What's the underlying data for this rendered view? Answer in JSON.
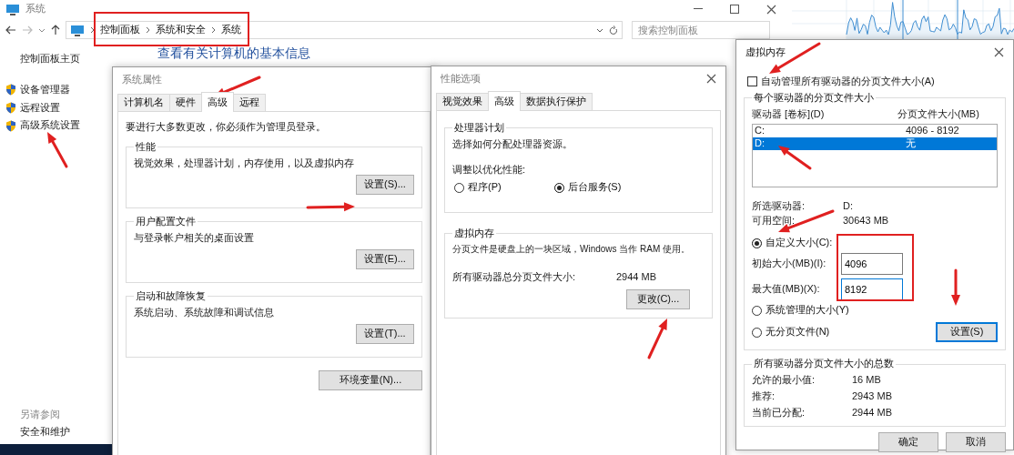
{
  "explorer": {
    "title": "系统",
    "breadcrumb": [
      "控制面板",
      "系统和安全",
      "系统"
    ],
    "search": {
      "placeholder": "搜索控制面板"
    },
    "heading": "查看有关计算机的基本信息",
    "sidebar": {
      "home": "控制面板主页",
      "items": [
        {
          "label": "设备管理器"
        },
        {
          "label": "远程设置"
        },
        {
          "label": "高级系统设置"
        }
      ],
      "see_also": "另请参阅",
      "links": [
        "安全和维护"
      ]
    }
  },
  "system_properties": {
    "title": "系统属性",
    "tabs": [
      {
        "label": "计算机名",
        "selected": false
      },
      {
        "label": "硬件",
        "selected": false
      },
      {
        "label": "高级",
        "selected": true
      },
      {
        "label": "远程",
        "selected": false
      }
    ],
    "note": "要进行大多数更改，你必须作为管理员登录。",
    "groups": [
      {
        "title": "性能",
        "text": "视觉效果，处理器计划，内存使用，以及虚拟内存",
        "button": "设置(S)..."
      },
      {
        "title": "用户配置文件",
        "text": "与登录帐户相关的桌面设置",
        "button": "设置(E)..."
      },
      {
        "title": "启动和故障恢复",
        "text": "系统启动、系统故障和调试信息",
        "button": "设置(T)..."
      }
    ],
    "env_button": "环境变量(N)..."
  },
  "performance_options": {
    "title": "性能选项",
    "tabs": [
      {
        "label": "视觉效果",
        "selected": false
      },
      {
        "label": "高级",
        "selected": true
      },
      {
        "label": "数据执行保护",
        "selected": false
      }
    ],
    "processor": {
      "title": "处理器计划",
      "text": "选择如何分配处理器资源。",
      "prompt": "调整以优化性能:",
      "options": [
        {
          "label": "程序(P)",
          "selected": false
        },
        {
          "label": "后台服务(S)",
          "selected": true
        }
      ]
    },
    "virtual_memory": {
      "title": "虚拟内存",
      "text": "分页文件是硬盘上的一块区域，Windows 当作 RAM 使用。",
      "total_label": "所有驱动器总分页文件大小:",
      "total_value": "2944 MB",
      "button": "更改(C)..."
    }
  },
  "virtual_memory": {
    "title": "虚拟内存",
    "auto_manage": {
      "label": "自动管理所有驱动器的分页文件大小(A)",
      "checked": false
    },
    "per_drive": {
      "title": "每个驱动器的分页文件大小",
      "columns": [
        "驱动器 [卷标](D)",
        "分页文件大小(MB)"
      ],
      "rows": [
        {
          "drive": "C:",
          "size": "4096 - 8192",
          "selected": false
        },
        {
          "drive": "D:",
          "size": "无",
          "selected": true
        }
      ],
      "selected_drive_label": "所选驱动器:",
      "selected_drive": "D:",
      "free_space_label": "可用空间:",
      "free_space": "30643 MB",
      "options": [
        {
          "label": "自定义大小(C):",
          "selected": true
        },
        {
          "label": "系统管理的大小(Y)",
          "selected": false
        },
        {
          "label": "无分页文件(N)",
          "selected": false
        }
      ],
      "fields": [
        {
          "label": "初始大小(MB)(I):",
          "value": "4096",
          "focused": false
        },
        {
          "label": "最大值(MB)(X):",
          "value": "8192",
          "focused": true
        }
      ],
      "set_button": {
        "label": "设置(S)",
        "focused": true
      }
    },
    "totals": {
      "title": "所有驱动器分页文件大小的总数",
      "rows": [
        {
          "label": "允许的最小值:",
          "value": "16 MB"
        },
        {
          "label": "推荐:",
          "value": "2943 MB"
        },
        {
          "label": "当前已分配:",
          "value": "2944 MB"
        }
      ]
    },
    "buttons": [
      "确定",
      "取消"
    ]
  }
}
